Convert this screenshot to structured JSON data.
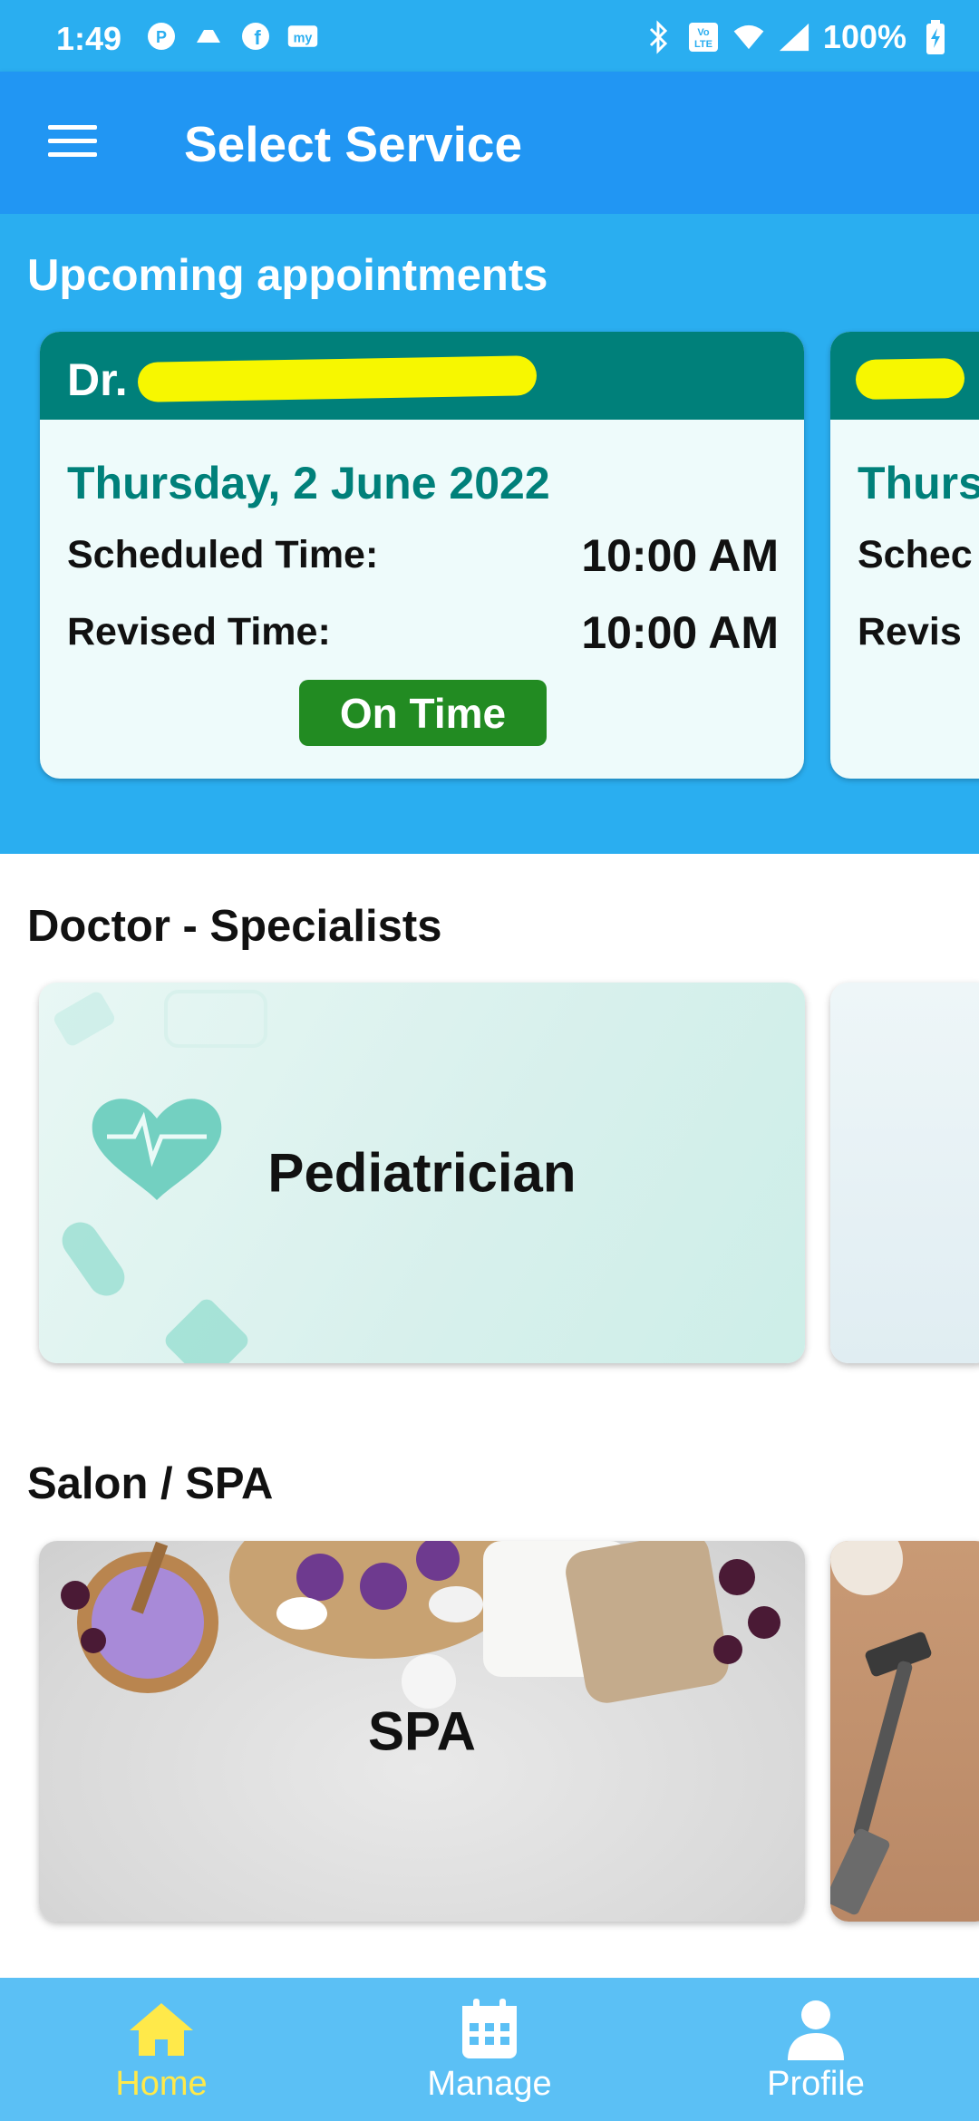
{
  "status_bar": {
    "time": "1:49",
    "battery": "100%",
    "icons": [
      "notification-icon",
      "bluetooth-icon",
      "volte-icon",
      "wifi-icon",
      "signal-icon",
      "battery-charging-icon"
    ]
  },
  "app_bar": {
    "title": "Select Service"
  },
  "upcoming": {
    "title": "Upcoming appointments",
    "cards": [
      {
        "doctor": "Dr.",
        "date": "Thursday, 2 June 2022",
        "scheduled_label": "Scheduled Time:",
        "scheduled_value": "10:00 AM",
        "revised_label": "Revised Time:",
        "revised_value": "10:00 AM",
        "status": "On Time"
      },
      {
        "doctor": "",
        "date": "Thurs",
        "scheduled_label": "Schec",
        "revised_label": "Revis"
      }
    ]
  },
  "categories": [
    {
      "title": "Doctor - Specialists",
      "items": [
        "Pediatrician"
      ]
    },
    {
      "title": "Salon / SPA",
      "items": [
        "SPA"
      ]
    }
  ],
  "bottom_nav": {
    "items": [
      {
        "label": "Home",
        "icon": "home-icon",
        "active": true
      },
      {
        "label": "Manage",
        "icon": "calendar-icon",
        "active": false
      },
      {
        "label": "Profile",
        "icon": "person-icon",
        "active": false
      }
    ]
  },
  "colors": {
    "status_bar": "#2aaef0",
    "app_bar": "#2196f3",
    "card_header": "#00807a",
    "on_time": "#228b22",
    "active_nav": "#ffe94a"
  }
}
